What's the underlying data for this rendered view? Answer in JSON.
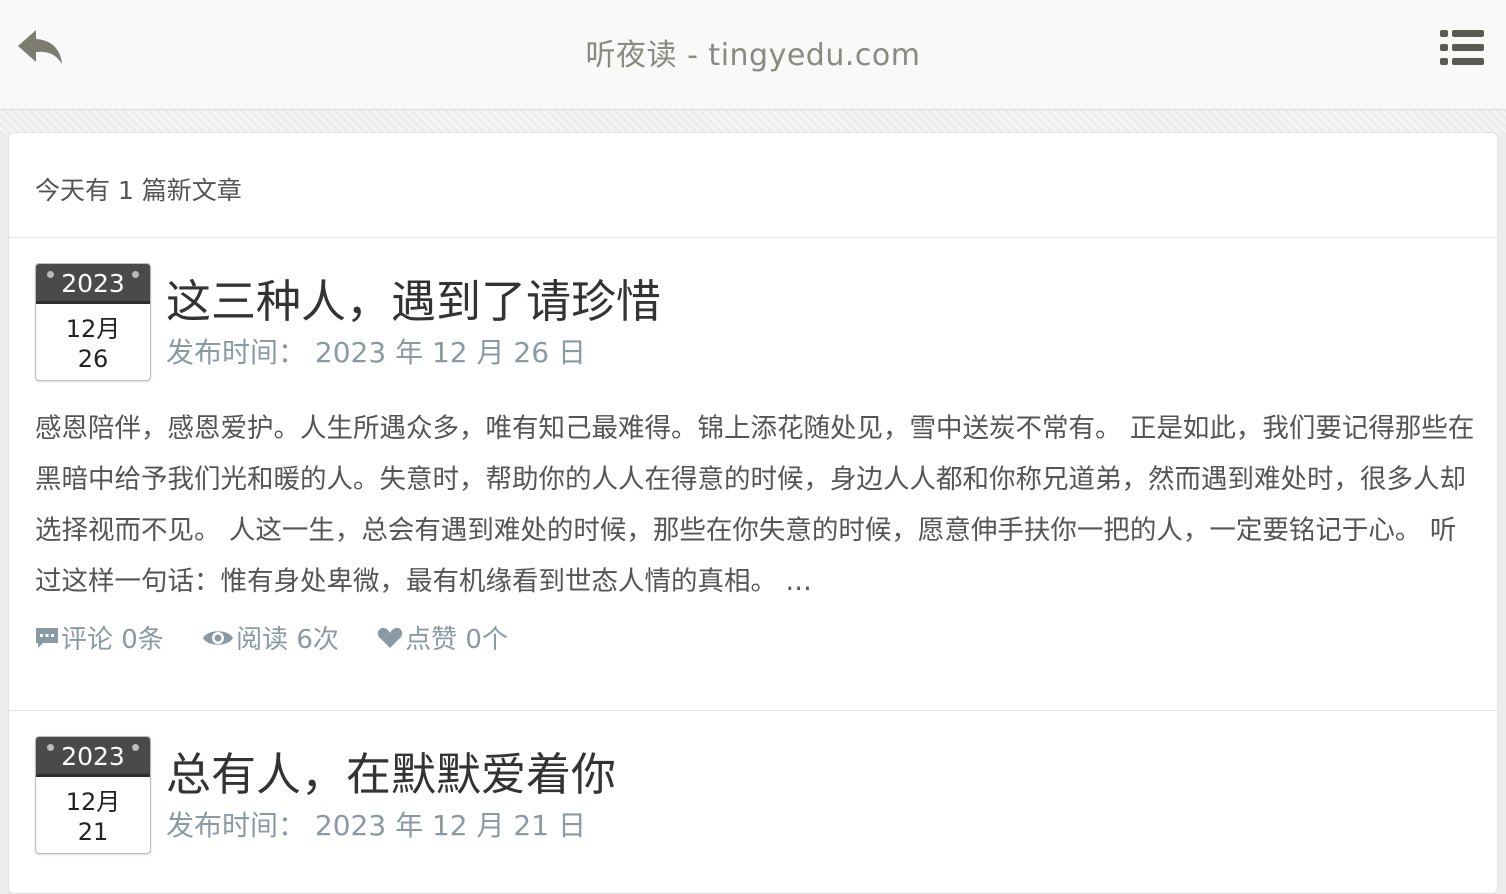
{
  "header": {
    "title": "听夜读 - tingyedu.com",
    "back_icon": "reply-arrow-icon",
    "menu_icon": "list-menu-icon"
  },
  "today_notice": "今天有 1 篇新文章",
  "posts": [
    {
      "cal_year": "2023",
      "cal_month": "12月",
      "cal_day": "26",
      "title": "这三种人，遇到了请珍惜",
      "date_label": "发布时间：",
      "date": "2023 年 12 月 26 日",
      "excerpt": "感恩陪伴，感恩爱护。人生所遇众多，唯有知己最难得。锦上添花随处见，雪中送炭不常有。 正是如此，我们要记得那些在黑暗中给予我们光和暖的人。失意时，帮助你的人人在得意的时候，身边人人都和你称兄道弟，然而遇到难处时，很多人却选择视而不见。 人这一生，总会有遇到难处的时候，那些在你失意的时候，愿意伸手扶你一把的人，一定要铭记于心。 听过这样一句话：惟有身处卑微，最有机缘看到世态人情的真相。 …",
      "comments": "评论 0条",
      "views": "阅读 6次",
      "likes": "点赞 0个"
    },
    {
      "cal_year": "2023",
      "cal_month": "12月",
      "cal_day": "21",
      "title": "总有人，在默默爱着你",
      "date_label": "发布时间：",
      "date": "2023 年 12 月 21 日"
    }
  ],
  "colors": {
    "header_bg": "#f9f9f9",
    "title_text": "#8a8a80",
    "meta_text": "#8a9aa5",
    "calendar_header": "#4a4a4a"
  }
}
